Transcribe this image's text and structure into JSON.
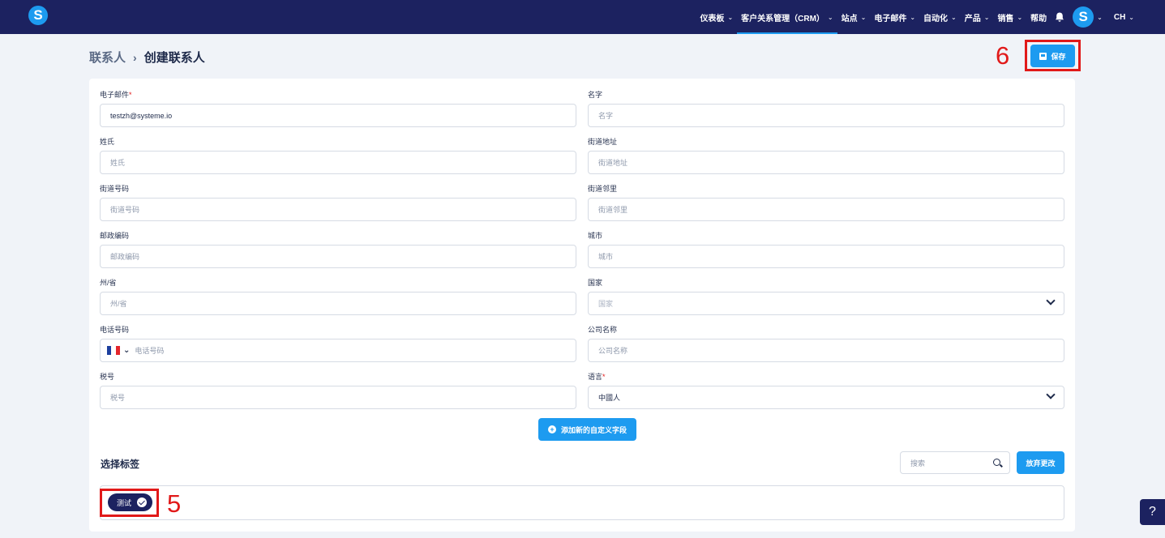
{
  "app": {
    "logo": "S"
  },
  "nav": {
    "items": [
      {
        "label": "仪表板",
        "has_menu": true
      },
      {
        "label": "客户关系管理（CRM）",
        "has_menu": true,
        "active": true
      },
      {
        "label": "站点",
        "has_menu": true
      },
      {
        "label": "电子邮件",
        "has_menu": true
      },
      {
        "label": "自动化",
        "has_menu": true
      },
      {
        "label": "产品",
        "has_menu": true
      },
      {
        "label": "销售",
        "has_menu": true
      },
      {
        "label": "帮助",
        "has_menu": false
      }
    ],
    "bell_icon": "bell-icon",
    "avatar": "S",
    "language": "CH",
    "chevron": "⌄"
  },
  "breadcrumb": {
    "parent": "联系人",
    "separator": "›",
    "current": "创建联系人"
  },
  "toolbar": {
    "save_label": "保存"
  },
  "annotations": {
    "a5": "5",
    "a6": "6"
  },
  "form": {
    "email": {
      "label": "电子邮件",
      "required": "*",
      "value": "testzh@systeme.io"
    },
    "first_name": {
      "label": "名字",
      "placeholder": "名字"
    },
    "last_name": {
      "label": "姓氏",
      "placeholder": "姓氏"
    },
    "street_address": {
      "label": "街道地址",
      "placeholder": "街道地址"
    },
    "street_number": {
      "label": "街道号码",
      "placeholder": "街道号码"
    },
    "street_neighborhood": {
      "label": "街道邻里",
      "placeholder": "街道邻里"
    },
    "postal_code": {
      "label": "邮政编码",
      "placeholder": "邮政编码"
    },
    "city": {
      "label": "城市",
      "placeholder": "城市"
    },
    "state": {
      "label": "州/省",
      "placeholder": "州/省"
    },
    "country": {
      "label": "国家",
      "placeholder": "国家"
    },
    "phone": {
      "label": "电话号码",
      "placeholder": "电话号码",
      "country_flag": "France"
    },
    "company": {
      "label": "公司名称",
      "placeholder": "公司名称"
    },
    "tax_id": {
      "label": "税号",
      "placeholder": "税号"
    },
    "language": {
      "label": "语言",
      "required": "*",
      "value": "中國人"
    }
  },
  "add_field_label": "添加新的自定义字段",
  "tags": {
    "title": "选择标签",
    "search_placeholder": "搜索",
    "discard_label": "放弃更改",
    "items": [
      {
        "label": "测试",
        "selected": true
      }
    ]
  },
  "help": {
    "label": "?"
  },
  "colors": {
    "navbar": "#1c2260",
    "accent": "#1d9bf0",
    "annotation": "#e11919",
    "page_bg": "#f0f3f8"
  }
}
